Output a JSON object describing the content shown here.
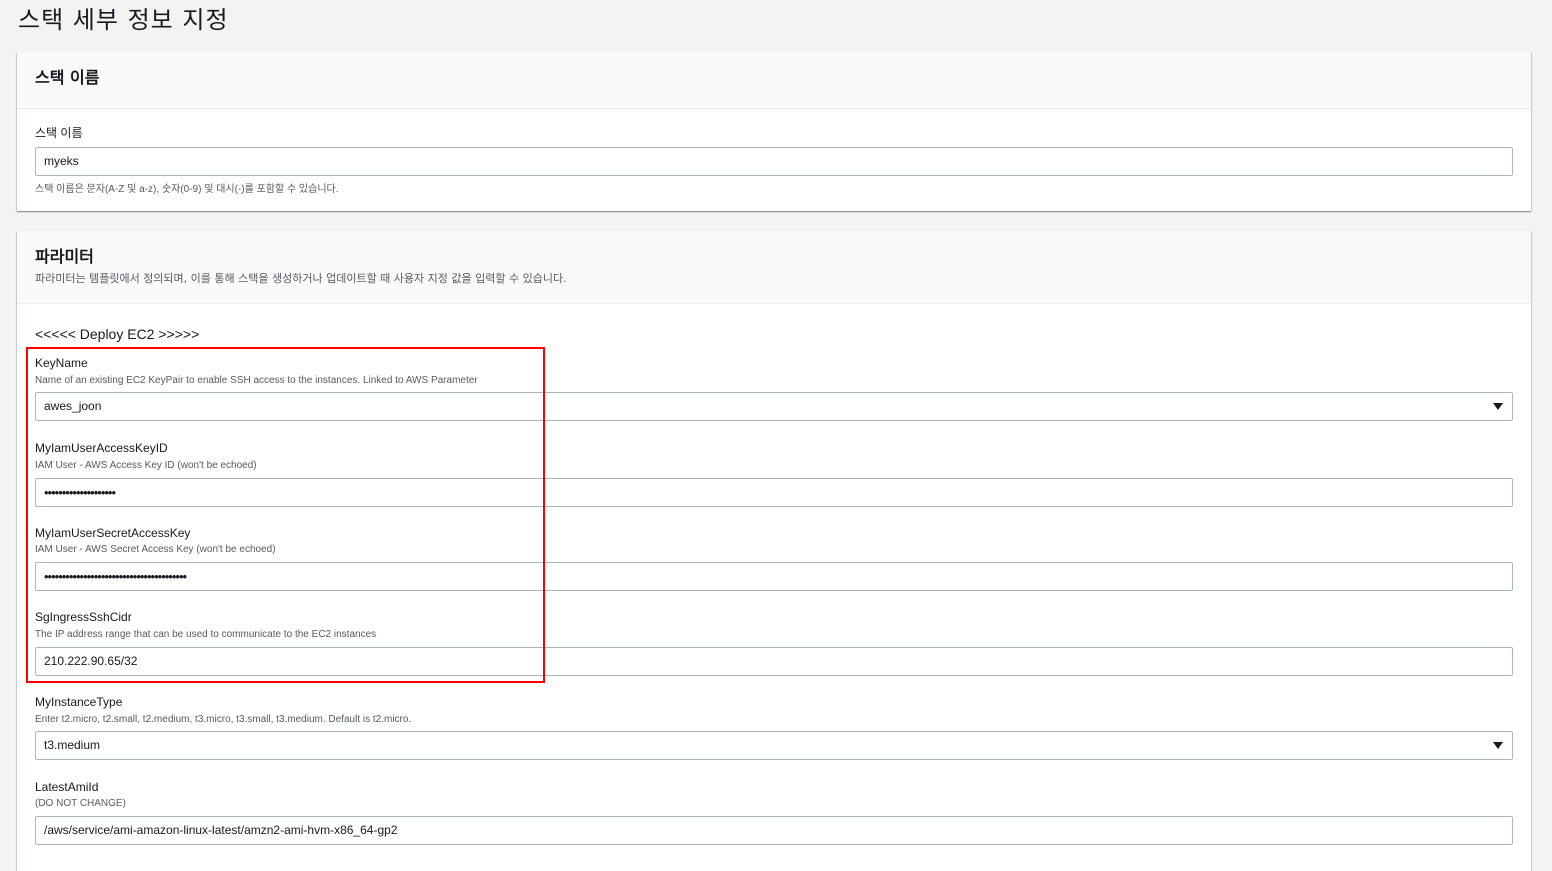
{
  "page": {
    "title": "스택 세부 정보 지정"
  },
  "stack_name_panel": {
    "header": "스택 이름",
    "label": "스택 이름",
    "value": "myeks",
    "hint": "스택 이름은 문자(A-Z 및 a-z), 숫자(0-9) 및 대시(-)를 포함할 수 있습니다."
  },
  "parameters_panel": {
    "header": "파라미터",
    "description": "파라미터는 템플릿에서 정의되며, 이를 통해 스택을 생성하거나 업데이트할 때 사용자 지정 값을 입력할 수 있습니다.",
    "group_label": "<<<<< Deploy EC2 >>>>>",
    "fields": [
      {
        "label": "KeyName",
        "description": "Name of an existing EC2 KeyPair to enable SSH access to the instances. Linked to AWS Parameter",
        "value": "awes_joon",
        "type": "select"
      },
      {
        "label": "MyIamUserAccessKeyID",
        "description": "IAM User - AWS Access Key ID (won't be echoed)",
        "value": "••••••••••••••••••••",
        "type": "password"
      },
      {
        "label": "MyIamUserSecretAccessKey",
        "description": "IAM User - AWS Secret Access Key (won't be echoed)",
        "value": "••••••••••••••••••••••••••••••••••••••••",
        "type": "password"
      },
      {
        "label": "SgIngressSshCidr",
        "description": "The IP address range that can be used to communicate to the EC2 instances",
        "value": "210.222.90.65/32",
        "type": "text"
      },
      {
        "label": "MyInstanceType",
        "description": "Enter t2.micro, t2.small, t2.medium, t3.micro, t3.small, t3.medium. Default is t2.micro.",
        "value": "t3.medium",
        "type": "select"
      },
      {
        "label": "LatestAmiId",
        "description": "(DO NOT CHANGE)",
        "value": "/aws/service/ami-amazon-linux-latest/amzn2-ami-hvm-x86_64-gp2",
        "type": "text"
      }
    ]
  },
  "annotation": {
    "highlight_color": "#ff0000"
  },
  "icons": {
    "select_caret": "caret-down-icon"
  }
}
